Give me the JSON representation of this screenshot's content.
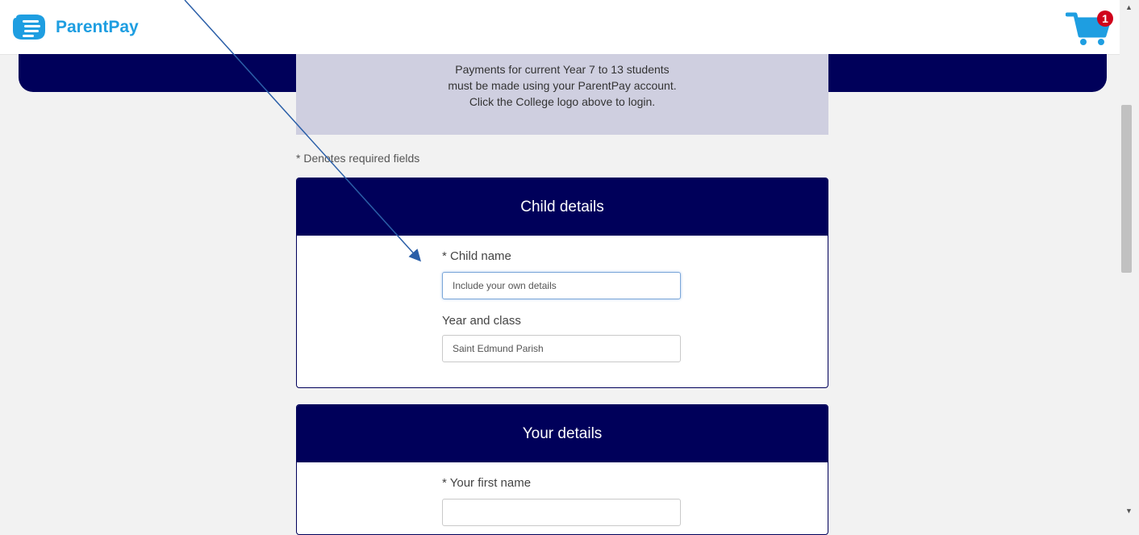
{
  "app": {
    "brand_name": "ParentPay",
    "brand_color": "#1e9ee1",
    "logo_icon": "parentpay-hand-icon"
  },
  "cart": {
    "icon": "shopping-cart-icon",
    "count": "1",
    "badge_color": "#d0021b"
  },
  "notice": {
    "lines": [
      "Payments for current Year 7 to 13 students",
      "must be made using your ParentPay account.",
      "Click the College logo above to login."
    ]
  },
  "form": {
    "required_note": "* Denotes required fields",
    "accent_color": "#00005a",
    "sections": [
      {
        "title": "Child details",
        "fields": [
          {
            "label": "* Child name",
            "value": "Include your own details",
            "placeholder": ""
          },
          {
            "label": "Year and class",
            "value": "Saint Edmund Parish",
            "placeholder": ""
          }
        ]
      },
      {
        "title": "Your details",
        "fields": [
          {
            "label": "* Your first name",
            "value": "",
            "placeholder": ""
          }
        ]
      }
    ]
  },
  "annotation": {
    "type": "arrow",
    "color": "#2b5fa8"
  }
}
